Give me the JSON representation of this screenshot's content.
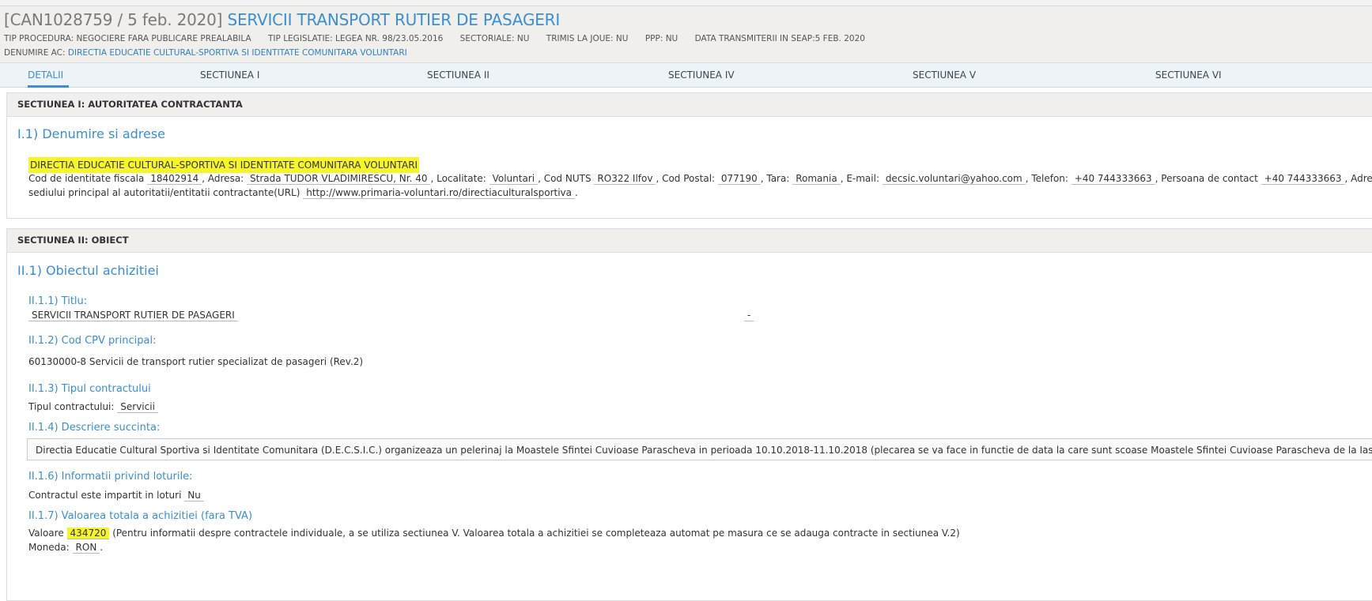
{
  "header": {
    "code": "[CAN1028759 / 5 feb. 2020]",
    "title": "SERVICII TRANSPORT RUTIER DE PASAGERI",
    "meta": [
      "TIP PROCEDURA: NEGOCIERE FARA PUBLICARE PREALABILA",
      "TIP LEGISLATIE: LEGEA NR. 98/23.05.2016",
      "SECTORIALE: NU",
      "TRIMIS LA JOUE: NU",
      "PPP: NU",
      "DATA TRANSMITERII IN SEAP:5 FEB. 2020"
    ],
    "denumire_label": "DENUMIRE AC:",
    "denumire_value": "DIRECTIA EDUCATIE CULTURAL-SPORTIVA SI IDENTITATE COMUNITARA VOLUNTARI"
  },
  "tabs": [
    "DETALII",
    "SECTIUNEA I",
    "SECTIUNEA II",
    "SECTIUNEA IV",
    "SECTIUNEA V",
    "SECTIUNEA VI"
  ],
  "colors": {
    "accent": "#3a8fd0",
    "highlight": "#f5f52a"
  },
  "section1": {
    "head": "SECTIUNEA I: AUTORITATEA CONTRACTANTA",
    "subtitle": "I.1) Denumire si adrese",
    "org_name": "DIRECTIA EDUCATIE CULTURAL-SPORTIVA SI IDENTITATE COMUNITARA VOLUNTARI",
    "cod_fiscal_label": "Cod de identitate fiscala",
    "cod_fiscal": "18402914",
    "adresa_label": ", Adresa:",
    "adresa": "Strada TUDOR VLADIMIRESCU, Nr. 40",
    "localitate_label": ", Localitate:",
    "localitate": "Voluntari",
    "nuts_label": ", Cod NUTS",
    "nuts": "RO322 Ilfov",
    "postal_label": ", Cod Postal:",
    "postal": "077190",
    "tara_label": ", Tara:",
    "tara": "Romania",
    "email_label": ", E-mail:",
    "email": "decsic.voluntari@yahoo.com",
    "telefon_label": ", Telefon:",
    "telefon": "+40 744333663",
    "contact_label": ", Persoana de contact",
    "contact": "+40 744333663",
    "adres_trunc": ", Adres",
    "url_label": "sediului principal al autoritatii/entitatii contractante(URL)",
    "url": "http://www.primaria-voluntari.ro/directiaculturalsportiva",
    "url_end": "."
  },
  "section2": {
    "head": "SECTIUNEA II: OBIECT",
    "subtitle": "II.1) Obiectul achizitiei",
    "titlu_label": "II.1.1) Titlu:",
    "titlu": "SERVICII TRANSPORT RUTIER DE PASAGERI",
    "titlu_dash": "-",
    "cpv_label": "II.1.2) Cod CPV principal:",
    "cpv": "60130000-8 Servicii de transport rutier specializat de pasageri (Rev.2)",
    "tip_label": "II.1.3) Tipul contractului",
    "tip_field_label": "Tipul contractului:",
    "tip_value": "Servicii",
    "descriere_label": "II.1.4) Descriere succinta:",
    "descriere": "Directia Educatie Cultural Sportiva si Identitate Comunitara (D.E.C.S.I.C.) organizeaza un pelerinaj la Moastele Sfintei Cuvioase Parascheva in perioada 10.10.2018-11.10.2018 (plecarea se va face in functie de data la care sunt scoase Moastele Sfintei Cuvioase Parascheva de la Iasi)",
    "loturi_label": "II.1.6) Informatii privind loturile:",
    "loturi_field_label": "Contractul este impartit in loturi",
    "loturi_value": "Nu",
    "valoare_label": "II.1.7) Valoarea totala a achizitiei (fara TVA)",
    "valoare_field_label": "Valoare",
    "valoare": "434720",
    "valoare_note": "(Pentru informatii despre contractele individuale, a se utiliza sectiunea V. Valoarea totala a achizitiei se completeaza automat pe masura ce se adauga contracte in sectiunea V.2)",
    "moneda_label": "Moneda:",
    "moneda": "RON",
    "moneda_end": "."
  }
}
